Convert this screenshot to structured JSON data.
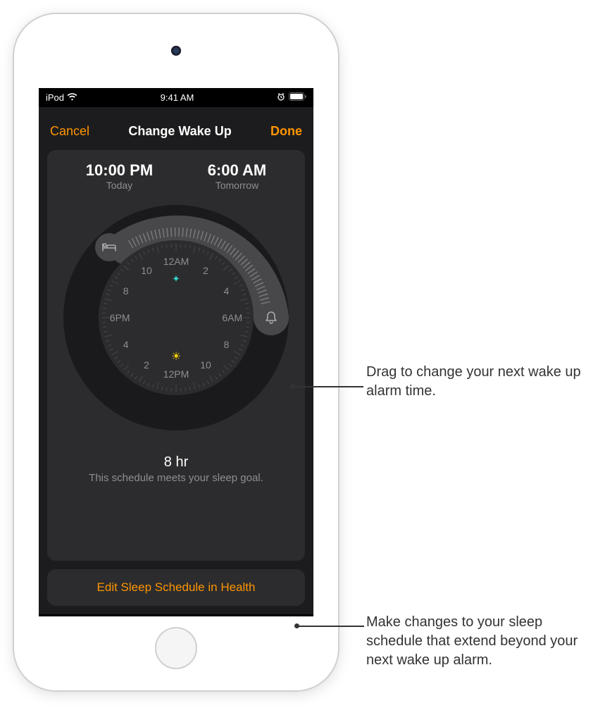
{
  "statusBar": {
    "carrier": "iPod",
    "time": "9:41 AM"
  },
  "nav": {
    "cancel": "Cancel",
    "title": "Change Wake Up",
    "done": "Done"
  },
  "bedtime": {
    "time": "10:00 PM",
    "label": "Today"
  },
  "wakeup": {
    "time": "6:00 AM",
    "label": "Tomorrow"
  },
  "clockLabels": {
    "12am": "12AM",
    "2": "2",
    "4": "4",
    "6am": "6AM",
    "8": "8",
    "10": "10",
    "12pm": "12PM",
    "2b": "2",
    "4b": "4",
    "6pm": "6PM",
    "8b": "8",
    "10b": "10"
  },
  "summary": {
    "hours": "8 hr",
    "text": "This schedule meets your sleep goal."
  },
  "editButton": "Edit Sleep Schedule in Health",
  "callouts": {
    "c1": "Drag to change your next wake up alarm time.",
    "c2": "Make changes to your sleep schedule that extend beyond your next wake up alarm."
  }
}
